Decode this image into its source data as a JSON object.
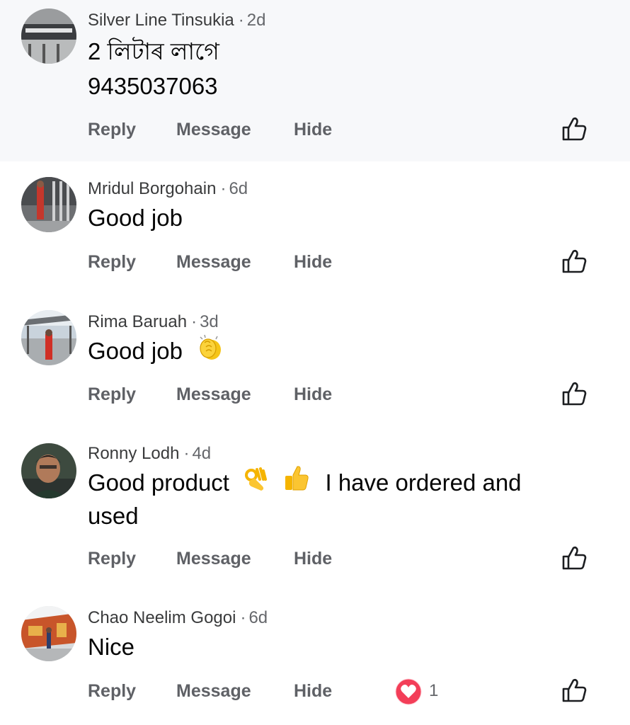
{
  "comments": [
    {
      "author": "Silver Line Tinsukia",
      "time": "2d",
      "text_lines": [
        "2 লিটাৰ লাগে",
        "9435037063"
      ],
      "actions": {
        "reply": "Reply",
        "message": "Message",
        "hide": "Hide"
      }
    },
    {
      "author": "Mridul Borgohain",
      "time": "6d",
      "text": "Good job",
      "actions": {
        "reply": "Reply",
        "message": "Message",
        "hide": "Hide"
      }
    },
    {
      "author": "Rima Baruah",
      "time": "3d",
      "text": "Good job",
      "emoji": "clapping-hands",
      "actions": {
        "reply": "Reply",
        "message": "Message",
        "hide": "Hide"
      }
    },
    {
      "author": "Ronny Lodh",
      "time": "4d",
      "text_part1": "Good product",
      "emojis": [
        "ok-hand",
        "thumbs-up"
      ],
      "text_part2": "I have ordered and",
      "text_line2": "used",
      "actions": {
        "reply": "Reply",
        "message": "Message",
        "hide": "Hide"
      }
    },
    {
      "author": "Chao Neelim Gogoi",
      "time": "6d",
      "text": "Nice",
      "actions": {
        "reply": "Reply",
        "message": "Message",
        "hide": "Hide"
      },
      "reaction": {
        "type": "love",
        "count": "1"
      }
    }
  ],
  "separator": "·",
  "icons": {
    "like": "thumbs-up-outline-icon",
    "reaction": "heart-icon"
  },
  "colors": {
    "highlight_bg": "#f7f8fa",
    "love": "#f33e58",
    "meta_grey": "#65676b"
  }
}
